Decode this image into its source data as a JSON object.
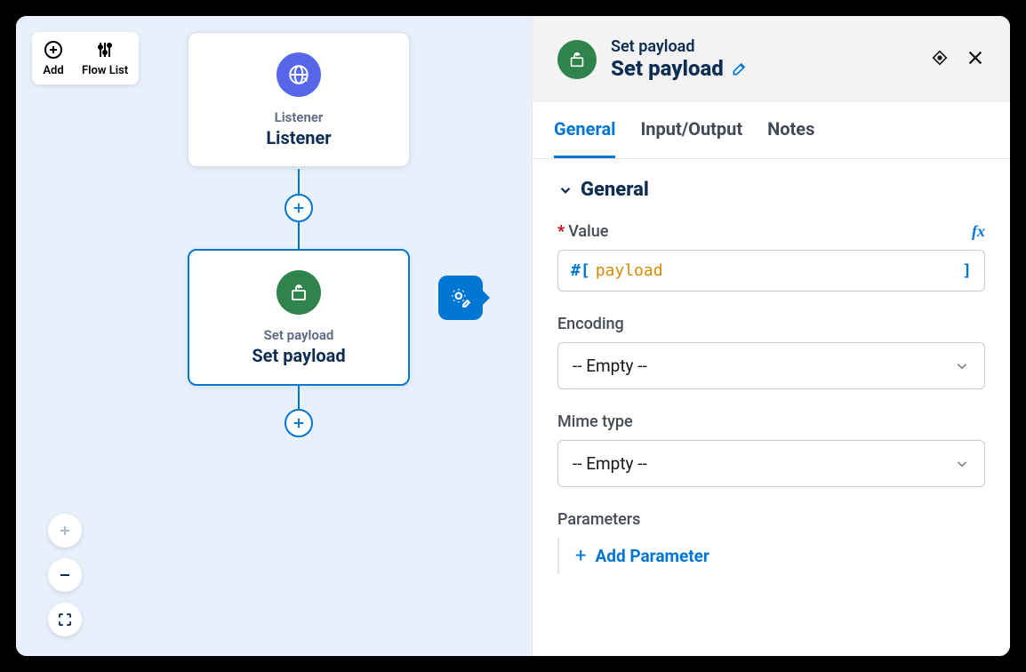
{
  "toolbar": {
    "add_label": "Add",
    "flowlist_label": "Flow List"
  },
  "nodes": {
    "listener": {
      "type": "Listener",
      "label": "Listener"
    },
    "setpayload": {
      "type": "Set payload",
      "label": "Set payload"
    }
  },
  "panel": {
    "subtitle": "Set payload",
    "title": "Set payload",
    "tabs": {
      "general": "General",
      "io": "Input/Output",
      "notes": "Notes"
    },
    "section": "General",
    "fields": {
      "value_label": "Value",
      "value_prefix": "#[",
      "value_content": "payload",
      "value_suffix": "]",
      "encoding_label": "Encoding",
      "encoding_value": "-- Empty --",
      "mime_label": "Mime type",
      "mime_value": "-- Empty --",
      "parameters_label": "Parameters",
      "add_param": "Add Parameter"
    }
  }
}
